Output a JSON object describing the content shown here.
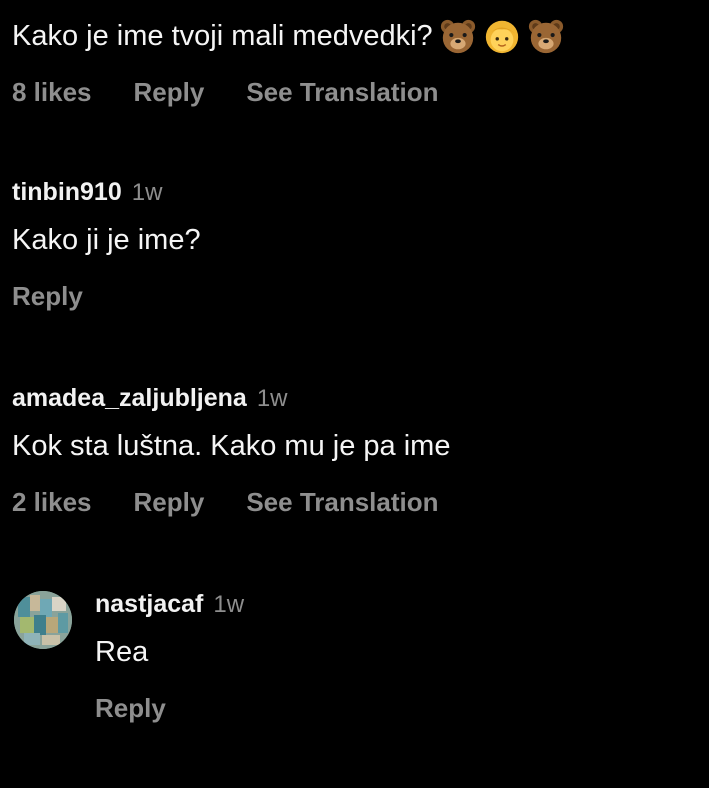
{
  "comments": [
    {
      "text": "Kako je ime tvoji mali medvedki?",
      "emoji_icons": [
        "bear-face-icon",
        "girl-face-icon",
        "bear-face-icon"
      ],
      "likes": "8 likes",
      "reply": "Reply",
      "translation": "See Translation"
    },
    {
      "username": "tinbin910",
      "time": "1w",
      "text": "Kako ji je ime?",
      "reply": "Reply"
    },
    {
      "username": "amadea_zaljubljena",
      "time": "1w",
      "text": "Kok sta luštna. Kako mu je pa ime",
      "likes": "2 likes",
      "reply": "Reply",
      "translation": "See Translation"
    },
    {
      "username": "nastjacaf",
      "time": "1w",
      "text": "Rea",
      "reply": "Reply"
    }
  ],
  "colors": {
    "background": "#000000",
    "primary_text": "#f5f5f5",
    "secondary_text": "#8e8e8e"
  }
}
